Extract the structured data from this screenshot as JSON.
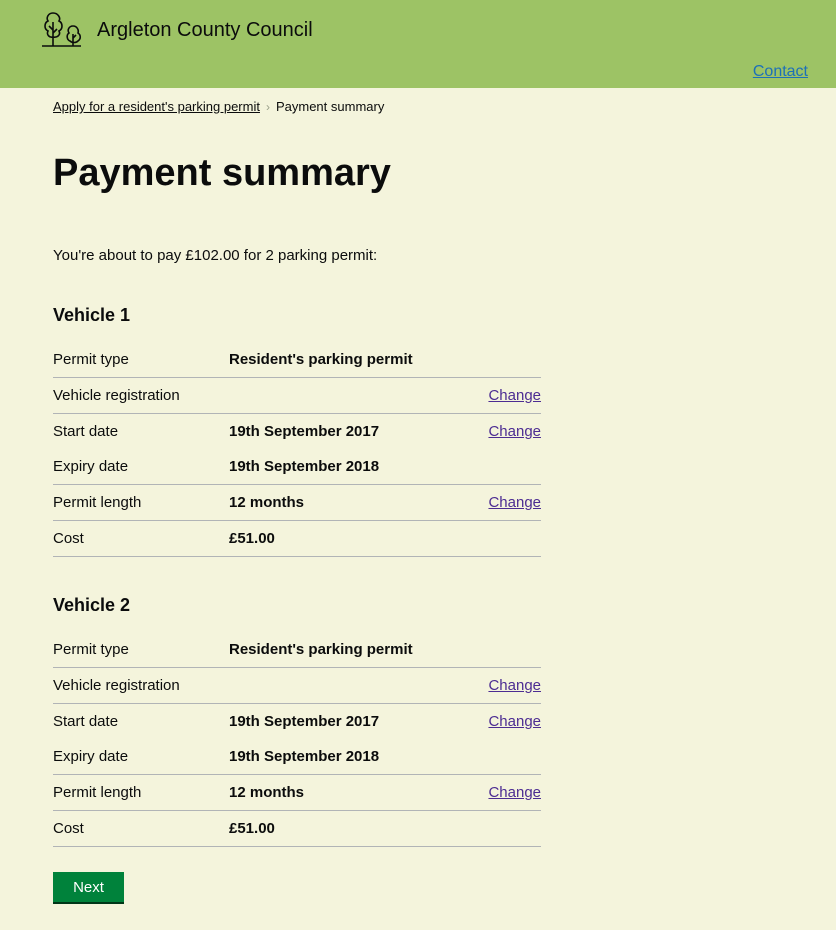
{
  "header": {
    "org_name": "Argleton County Council",
    "contact_label": "Contact",
    "logo_icon": "trees-logo-icon"
  },
  "breadcrumb": {
    "parent": "Apply for a resident's parking permit",
    "current": "Payment summary"
  },
  "page": {
    "title": "Payment summary",
    "intro": "You're about to pay £102.00 for 2 parking permit:"
  },
  "vehicles": [
    {
      "heading": "Vehicle 1",
      "rows": [
        {
          "key": "Permit type",
          "value": "Resident's parking permit",
          "change": ""
        },
        {
          "key": "Vehicle registration",
          "value": "",
          "change": "Change"
        },
        {
          "key": "Start date",
          "value": "19th September 2017",
          "change": "Change"
        },
        {
          "key": "Expiry date",
          "value": "19th September 2018",
          "change": ""
        },
        {
          "key": "Permit length",
          "value": "12 months",
          "change": "Change"
        },
        {
          "key": "Cost",
          "value": "£51.00",
          "change": ""
        }
      ]
    },
    {
      "heading": "Vehicle 2",
      "rows": [
        {
          "key": "Permit type",
          "value": "Resident's parking permit",
          "change": ""
        },
        {
          "key": "Vehicle registration",
          "value": "",
          "change": "Change"
        },
        {
          "key": "Start date",
          "value": "19th September 2017",
          "change": "Change"
        },
        {
          "key": "Expiry date",
          "value": "19th September 2018",
          "change": ""
        },
        {
          "key": "Permit length",
          "value": "12 months",
          "change": "Change"
        },
        {
          "key": "Cost",
          "value": "£51.00",
          "change": ""
        }
      ]
    }
  ],
  "actions": {
    "next_label": "Next"
  },
  "colors": {
    "header_bg": "#9dc365",
    "page_bg": "#f4f4dc",
    "link": "#4c2c92",
    "button": "#00823b"
  }
}
